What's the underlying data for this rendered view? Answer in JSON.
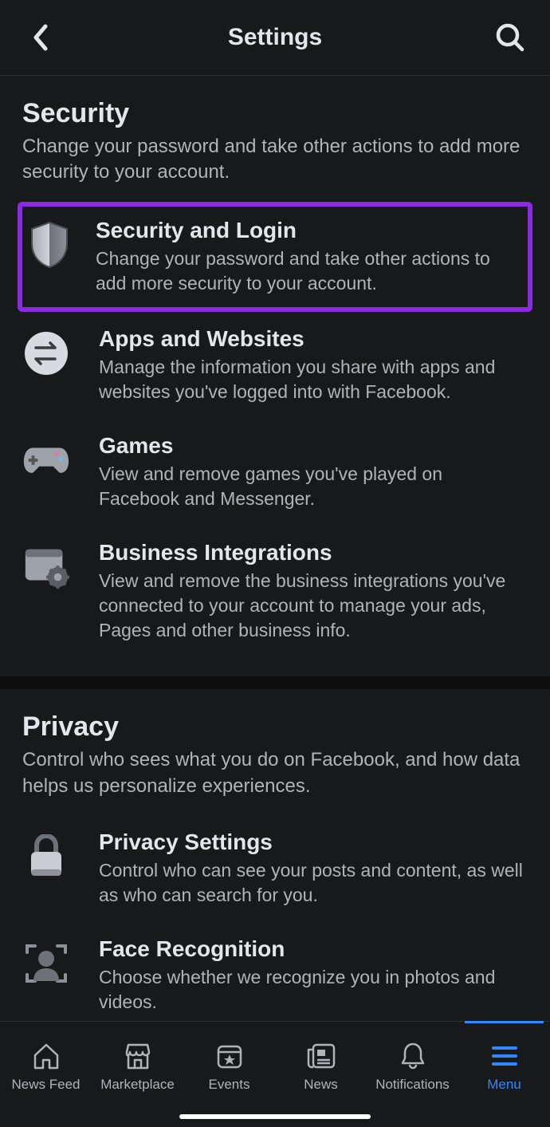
{
  "header": {
    "title": "Settings"
  },
  "sections": {
    "security": {
      "title": "Security",
      "desc": "Change your password and take other actions to add more security to your account.",
      "items": {
        "security_login": {
          "title": "Security and Login",
          "desc": "Change your password and take other actions to add more security to your account."
        },
        "apps_websites": {
          "title": "Apps and Websites",
          "desc": "Manage the information you share with apps and websites you've logged into with Facebook."
        },
        "games": {
          "title": "Games",
          "desc": "View and remove games you've played on Facebook and Messenger."
        },
        "business": {
          "title": "Business Integrations",
          "desc": "View and remove the business integrations you've connected to your account to manage your ads, Pages and other business info."
        }
      }
    },
    "privacy": {
      "title": "Privacy",
      "desc": "Control who sees what you do on Facebook, and how data helps us personalize experiences.",
      "items": {
        "privacy_settings": {
          "title": "Privacy Settings",
          "desc": "Control who can see your posts and content, as well as who can search for you."
        },
        "face_recognition": {
          "title": "Face Recognition",
          "desc": "Choose whether we recognize you in photos and videos."
        }
      }
    }
  },
  "tabs": {
    "news_feed": "News Feed",
    "marketplace": "Marketplace",
    "events": "Events",
    "news": "News",
    "notifications": "Notifications",
    "menu": "Menu"
  },
  "highlight_color": "#8a2be2"
}
